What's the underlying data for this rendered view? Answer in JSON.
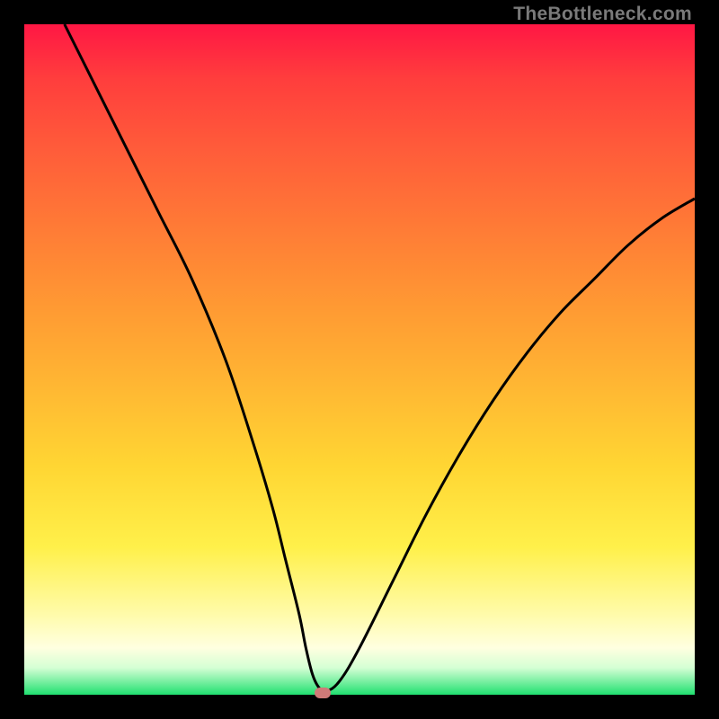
{
  "watermark": "TheBottleneck.com",
  "chart_data": {
    "type": "line",
    "title": "",
    "xlabel": "",
    "ylabel": "",
    "xlim": [
      0,
      100
    ],
    "ylim": [
      0,
      100
    ],
    "grid": false,
    "series": [
      {
        "name": "curve",
        "color": "#000000",
        "x": [
          6,
          10,
          15,
          20,
          25,
          30,
          34,
          37,
          39,
          41,
          42,
          43,
          44,
          45,
          47,
          50,
          55,
          60,
          65,
          70,
          75,
          80,
          85,
          90,
          95,
          100
        ],
        "y": [
          100,
          92,
          82,
          72,
          62,
          50,
          38,
          28,
          20,
          12,
          7,
          3,
          1,
          0.5,
          2,
          7,
          17,
          27,
          36,
          44,
          51,
          57,
          62,
          67,
          71,
          74
        ]
      }
    ],
    "marker": {
      "x": 44.5,
      "y": 0.3,
      "color": "#d07a78"
    },
    "background_gradient": {
      "top": "#ff1744",
      "middle": "#ffd633",
      "bottom": "#20e070"
    }
  }
}
